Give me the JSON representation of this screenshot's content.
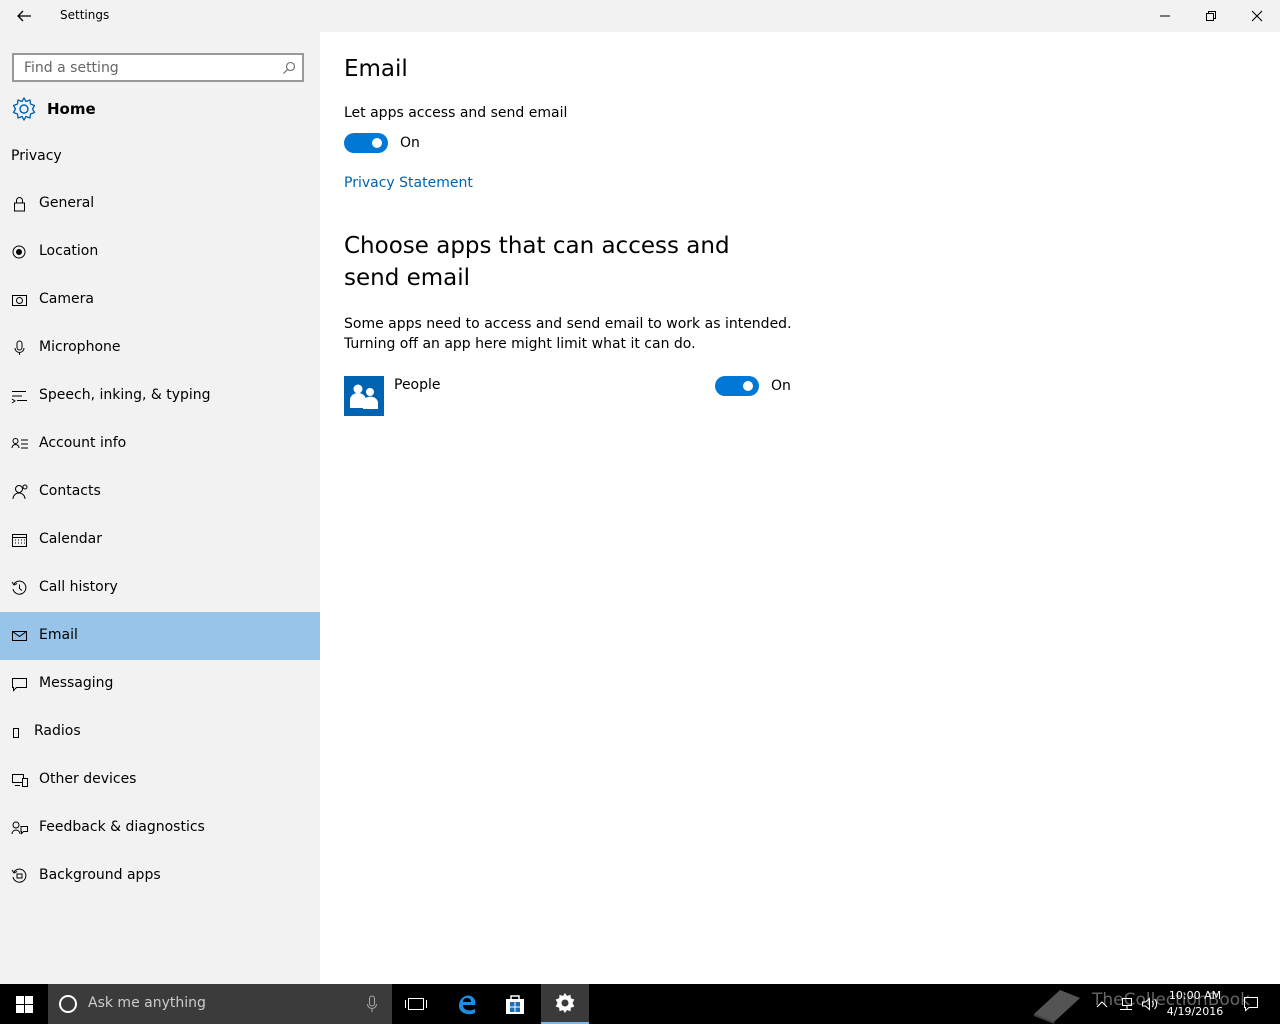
{
  "window": {
    "title": "Settings"
  },
  "sidebar": {
    "search_placeholder": "Find a setting",
    "home_label": "Home",
    "section_label": "Privacy",
    "items": [
      {
        "label": "General",
        "icon": "lock-icon",
        "active": false
      },
      {
        "label": "Location",
        "icon": "location-icon",
        "active": false
      },
      {
        "label": "Camera",
        "icon": "camera-icon",
        "active": false
      },
      {
        "label": "Microphone",
        "icon": "microphone-icon",
        "active": false
      },
      {
        "label": "Speech, inking, & typing",
        "icon": "speech-icon",
        "active": false
      },
      {
        "label": "Account info",
        "icon": "account-info-icon",
        "active": false
      },
      {
        "label": "Contacts",
        "icon": "contacts-icon",
        "active": false
      },
      {
        "label": "Calendar",
        "icon": "calendar-icon",
        "active": false
      },
      {
        "label": "Call history",
        "icon": "call-history-icon",
        "active": false
      },
      {
        "label": "Email",
        "icon": "mail-icon",
        "active": true
      },
      {
        "label": "Messaging",
        "icon": "messaging-icon",
        "active": false
      },
      {
        "label": "Radios",
        "icon": "radios-icon",
        "active": false
      },
      {
        "label": "Other devices",
        "icon": "other-devices-icon",
        "active": false
      },
      {
        "label": "Feedback & diagnostics",
        "icon": "feedback-icon",
        "active": false
      },
      {
        "label": "Background apps",
        "icon": "background-apps-icon",
        "active": false
      }
    ]
  },
  "main": {
    "title": "Email",
    "access_label": "Let apps access and send email",
    "access_toggle_state": "On",
    "privacy_link": "Privacy Statement",
    "apps_heading": "Choose apps that can access and send email",
    "apps_description_line1": "Some apps need to access and send email to work as intended.",
    "apps_description_line2": "Turning off an app here might limit what it can do.",
    "apps": [
      {
        "name": "People",
        "toggle_state": "On",
        "icon": "people-icon"
      }
    ]
  },
  "taskbar": {
    "search_placeholder": "Ask me anything",
    "clock_time": "10:00 AM",
    "clock_date": "4/19/2016",
    "watermark_text": "TheCollectionBook"
  },
  "colors": {
    "accent": "#0078d7",
    "link": "#0063b1",
    "sidebar_bg": "#f2f2f2",
    "active_item_bg": "#99c4e9",
    "taskbar_bg": "#000000"
  }
}
